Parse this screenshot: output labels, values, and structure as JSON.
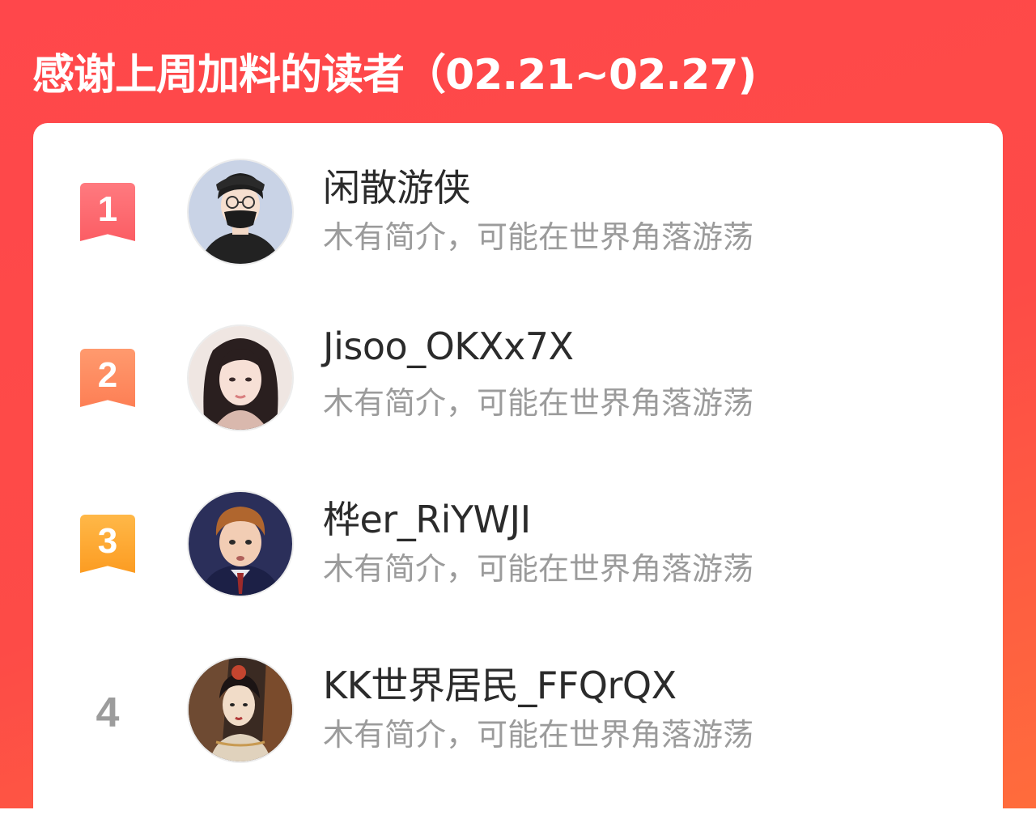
{
  "header": {
    "title": "感谢上周加料的读者（02.21~02.27)"
  },
  "readers": [
    {
      "rank": "1",
      "name": "闲散游侠",
      "bio": "木有简介，可能在世界角落游荡",
      "avatar_icon": "avatar-man-glasses-mask"
    },
    {
      "rank": "2",
      "name": "Jisoo_OKXx7X",
      "bio": "木有简介，可能在世界角落游荡",
      "avatar_icon": "avatar-woman-dark-hair"
    },
    {
      "rank": "3",
      "name": "桦er_RiYWJI",
      "bio": "木有简介，可能在世界角落游荡",
      "avatar_icon": "avatar-boy-ginger-hair"
    },
    {
      "rank": "4",
      "name": "KK世界居民_FFQrQX",
      "bio": "木有简介，可能在世界角落游荡",
      "avatar_icon": "avatar-illustrated-woman"
    }
  ],
  "colors": {
    "background_top": "#ff474b",
    "background_bottom": "#ff6c3c",
    "rank1": "#fb5d64",
    "rank2": "#fd7f55",
    "rank3": "#fc9c22",
    "rank_plain": "#9c9c9c",
    "name": "#2b2b2b",
    "bio": "#9b9b9b"
  }
}
